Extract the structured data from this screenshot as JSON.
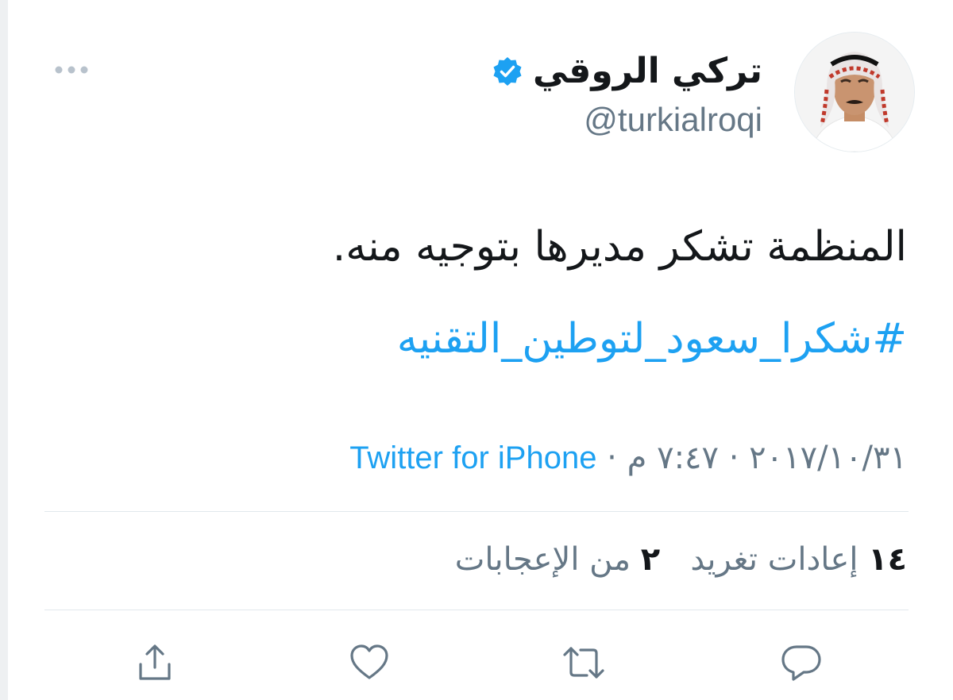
{
  "author": {
    "display_name": "تركي الروقي",
    "handle": "@turkialroqi",
    "verified": true
  },
  "tweet": {
    "text": "المنظمة تشكر مديرها بتوجيه منه.",
    "hashtag": "#شكرا_سعود_لتوطين_التقنيه",
    "date": "٢٠١٧/١٠/٣١",
    "time": "٧:٤٧ م",
    "separator": "·",
    "source": "Twitter for iPhone"
  },
  "stats": {
    "retweets_count": "١٤",
    "retweets_label": "إعادات تغريد",
    "likes_count": "٢",
    "likes_label": "من الإعجابات"
  },
  "icons": {
    "more": "more-dots-icon",
    "verified": "verified-badge-icon",
    "reply": "reply-icon",
    "retweet": "retweet-icon",
    "like": "like-heart-icon",
    "share": "share-icon"
  },
  "colors": {
    "accent": "#1da1f2",
    "secondary_text": "#657786",
    "primary_text": "#14171a",
    "divider": "#e1e8ed",
    "icon": "#657786"
  }
}
